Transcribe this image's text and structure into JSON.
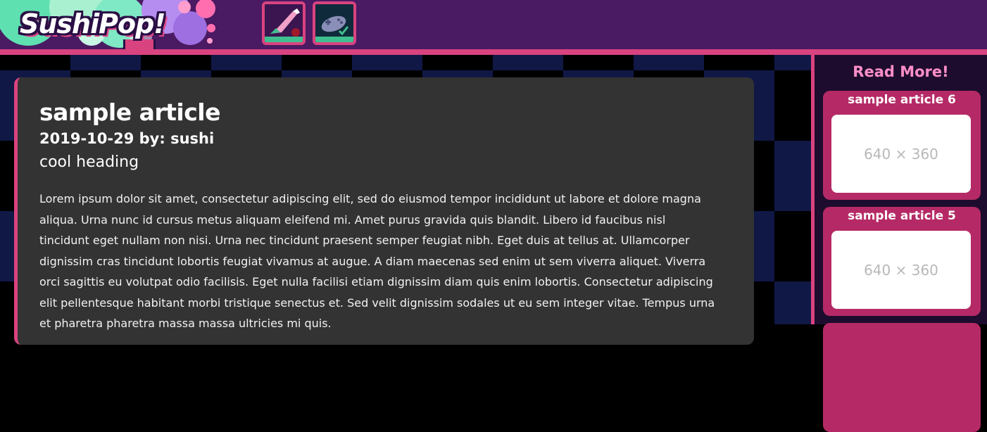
{
  "header": {
    "logo_text": "SushiPop!",
    "nav": [
      {
        "icon": "paintbrush-icon"
      },
      {
        "icon": "gamepad-icon"
      }
    ]
  },
  "article": {
    "title": "sample article",
    "meta": "2019-10-29 by: sushi",
    "heading": "cool heading",
    "body": "Lorem ipsum dolor sit amet, consectetur adipiscing elit, sed do eiusmod tempor incididunt ut labore et dolore magna aliqua. Urna nunc id cursus metus aliquam eleifend mi. Amet purus gravida quis blandit. Libero id faucibus nisl tincidunt eget nullam non nisi. Urna nec tincidunt praesent semper feugiat nibh. Eget duis at tellus at. Ullamcorper dignissim cras tincidunt lobortis feugiat vivamus at augue. A diam maecenas sed enim ut sem viverra aliquet. Viverra orci sagittis eu volutpat odio facilisis. Eget nulla facilisi etiam dignissim diam quis enim lobortis. Consectetur adipiscing elit pellentesque habitant morbi tristique senectus et. Sed velit dignissim sodales ut eu sem integer vitae. Tempus urna et pharetra pharetra massa massa ultricies mi quis."
  },
  "sidebar": {
    "title": "Read More!",
    "articles": [
      {
        "title": "sample article 6",
        "thumb": "640 × 360"
      },
      {
        "title": "sample article 5",
        "thumb": "640 × 360"
      }
    ]
  },
  "colors": {
    "header_bg": "#4a1a63",
    "accent_pink": "#d9437f",
    "card_bg": "#333333",
    "sidebar_title": "#ff8fc8",
    "side_card": "#b52a66"
  }
}
